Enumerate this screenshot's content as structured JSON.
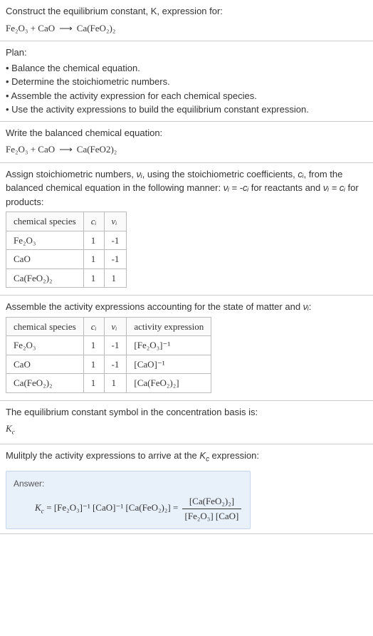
{
  "intro": {
    "prompt": "Construct the equilibrium constant, K, expression for:",
    "equation_lhs1": "Fe₂O₃",
    "equation_plus": " + ",
    "equation_lhs2": "CaO",
    "equation_arrow": "⟶",
    "equation_rhs": "Ca(FeO₂)₂"
  },
  "plan": {
    "header": "Plan:",
    "items": [
      "• Balance the chemical equation.",
      "• Determine the stoichiometric numbers.",
      "• Assemble the activity expression for each chemical species.",
      "• Use the activity expressions to build the equilibrium constant expression."
    ]
  },
  "balanced": {
    "prompt": "Write the balanced chemical equation:",
    "equation_lhs1": "Fe₂O₃",
    "equation_plus": " + ",
    "equation_lhs2": "CaO",
    "equation_arrow": "⟶",
    "equation_rhs": "Ca(FeO2)₂"
  },
  "stoich": {
    "prompt_part1": "Assign stoichiometric numbers, ",
    "prompt_var1": "νᵢ",
    "prompt_part2": ", using the stoichiometric coefficients, ",
    "prompt_var2": "cᵢ",
    "prompt_part3": ", from the balanced chemical equation in the following manner: ",
    "prompt_rel1": "νᵢ = -cᵢ",
    "prompt_part4": " for reactants and ",
    "prompt_rel2": "νᵢ = cᵢ",
    "prompt_part5": " for products:",
    "table": {
      "headers": [
        "chemical species",
        "cᵢ",
        "νᵢ"
      ],
      "rows": [
        {
          "species": "Fe₂O₃",
          "c": "1",
          "v": "-1"
        },
        {
          "species": "CaO",
          "c": "1",
          "v": "-1"
        },
        {
          "species": "Ca(FeO₂)₂",
          "c": "1",
          "v": "1"
        }
      ]
    }
  },
  "activity": {
    "prompt_part1": "Assemble the activity expressions accounting for the state of matter and ",
    "prompt_var": "νᵢ",
    "prompt_part2": ":",
    "table": {
      "headers": [
        "chemical species",
        "cᵢ",
        "νᵢ",
        "activity expression"
      ],
      "rows": [
        {
          "species": "Fe₂O₃",
          "c": "1",
          "v": "-1",
          "expr": "[Fe₂O₃]⁻¹"
        },
        {
          "species": "CaO",
          "c": "1",
          "v": "-1",
          "expr": "[CaO]⁻¹"
        },
        {
          "species": "Ca(FeO₂)₂",
          "c": "1",
          "v": "1",
          "expr": "[Ca(FeO₂)₂]"
        }
      ]
    }
  },
  "symbol": {
    "prompt": "The equilibrium constant symbol in the concentration basis is:",
    "value": "K_c"
  },
  "multiply": {
    "prompt_part1": "Mulitply the activity expressions to arrive at the ",
    "prompt_var": "K_c",
    "prompt_part2": " expression:"
  },
  "answer": {
    "label": "Answer:",
    "lhs": "K_c = ",
    "term1": "[Fe₂O₃]⁻¹",
    "term2": " [CaO]⁻¹",
    "term3": " [Ca(FeO₂)₂]",
    "eq": " = ",
    "frac_num": "[Ca(FeO₂)₂]",
    "frac_den": "[Fe₂O₃] [CaO]"
  },
  "chart_data": {
    "type": "table",
    "tables": [
      {
        "title": "Stoichiometric numbers",
        "columns": [
          "chemical species",
          "c_i",
          "ν_i"
        ],
        "rows": [
          [
            "Fe2O3",
            1,
            -1
          ],
          [
            "CaO",
            1,
            -1
          ],
          [
            "Ca(FeO2)2",
            1,
            1
          ]
        ]
      },
      {
        "title": "Activity expressions",
        "columns": [
          "chemical species",
          "c_i",
          "ν_i",
          "activity expression"
        ],
        "rows": [
          [
            "Fe2O3",
            1,
            -1,
            "[Fe2O3]^-1"
          ],
          [
            "CaO",
            1,
            -1,
            "[CaO]^-1"
          ],
          [
            "Ca(FeO2)2",
            1,
            1,
            "[Ca(FeO2)2]"
          ]
        ]
      }
    ]
  }
}
